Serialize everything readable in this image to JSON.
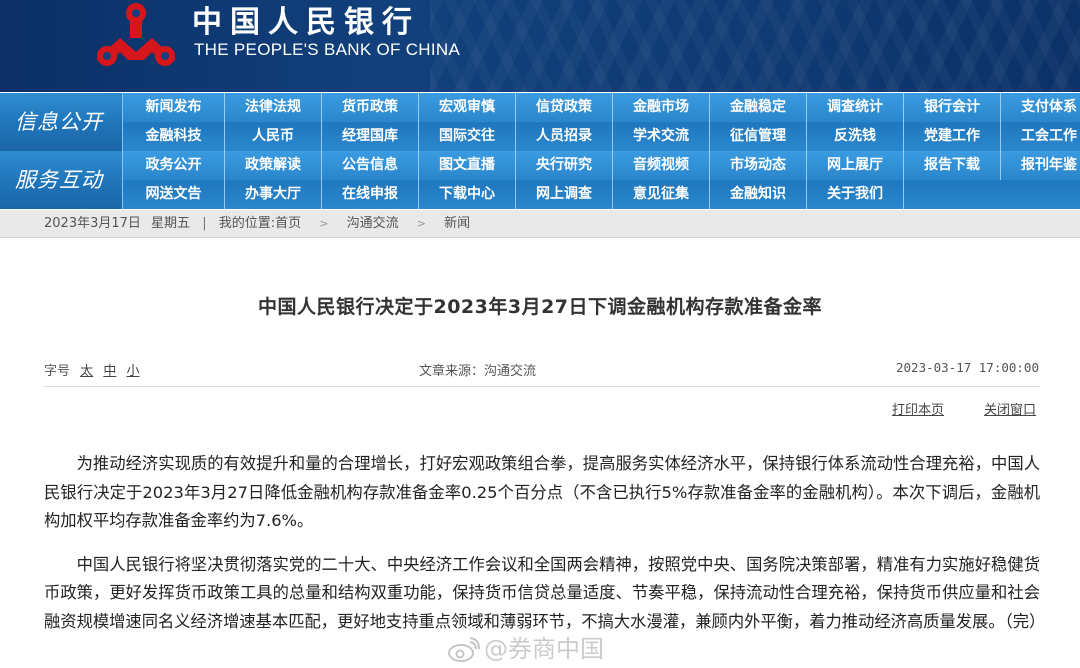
{
  "header": {
    "bank_name_cn": "中国人民银行",
    "bank_name_en": "THE PEOPLE'S BANK OF CHINA",
    "logo_icon": "pboc-logo-icon",
    "colors": {
      "banner": "#0f3a73",
      "logo_red": "#d7161b",
      "nav_blue": "#2a86cc"
    }
  },
  "nav": {
    "info": {
      "label": "信息公开",
      "row1": [
        "新闻发布",
        "法律法规",
        "货币政策",
        "宏观审慎",
        "信贷政策",
        "金融市场",
        "金融稳定",
        "调查统计",
        "银行会计",
        "支付体系"
      ],
      "row2": [
        "金融科技",
        "人民币",
        "经理国库",
        "国际交往",
        "人员招录",
        "学术交流",
        "征信管理",
        "反洗钱",
        "党建工作",
        "工会工作"
      ]
    },
    "service": {
      "label": "服务互动",
      "row1": [
        "政务公开",
        "政策解读",
        "公告信息",
        "图文直播",
        "央行研究",
        "音频视频",
        "市场动态",
        "网上展厅",
        "报告下载",
        "报刊年鉴"
      ],
      "row2": [
        "网送文告",
        "办事大厅",
        "在线申报",
        "下载中心",
        "网上调查",
        "意见征集",
        "金融知识",
        "关于我们"
      ]
    }
  },
  "breadcrumb": {
    "date": "2023年3月17日",
    "weekday": "星期五",
    "location_prefix": "我的位置:首页",
    "crumb1": "沟通交流",
    "crumb2": "新闻"
  },
  "article": {
    "title": "中国人民银行决定于2023年3月27日下调金融机构存款准备金率",
    "font_size_label": "字号",
    "font_sizes": [
      "太",
      "中",
      "小"
    ],
    "source": "文章来源：沟通交流",
    "publish_time": "2023-03-17  17:00:00",
    "print_label": "打印本页",
    "close_label": "关闭窗口",
    "paragraphs": [
      "为推动经济实现质的有效提升和量的合理增长，打好宏观政策组合拳，提高服务实体经济水平，保持银行体系流动性合理充裕，中国人民银行决定于2023年3月27日降低金融机构存款准备金率0.25个百分点（不含已执行5%存款准备金率的金融机构）。本次下调后，金融机构加权平均存款准备金率约为7.6%。",
      "中国人民银行将坚决贯彻落实党的二十大、中央经济工作会议和全国两会精神，按照党中央、国务院决策部署，精准有力实施好稳健货币政策，更好发挥货币政策工具的总量和结构双重功能，保持货币信贷总量适度、节奏平稳，保持流动性合理充裕，保持货币供应量和社会融资规模增速同名义经济增速基本匹配，更好地支持重点领域和薄弱环节，不搞大水漫灌，兼顾内外平衡，着力推动经济高质量发展。（完）"
    ]
  },
  "watermark": {
    "text": "@券商中国",
    "icon": "weibo-icon"
  }
}
